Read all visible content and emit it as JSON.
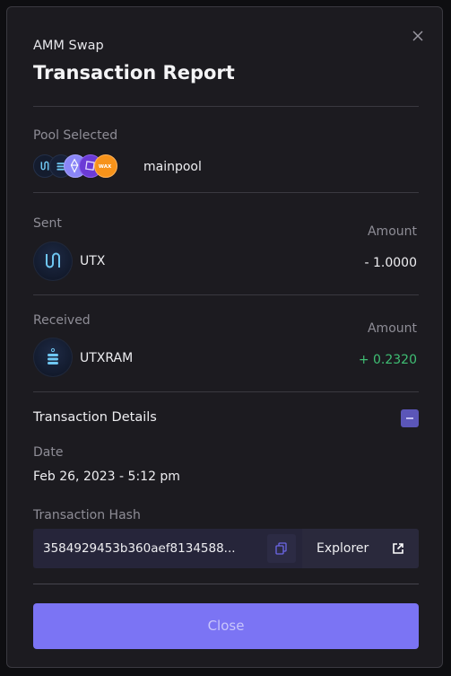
{
  "modal": {
    "subtitle": "AMM Swap",
    "title": "Transaction Report"
  },
  "pool": {
    "label": "Pool Selected",
    "name": "mainpool",
    "icons": [
      "utx-icon",
      "utxram-icon",
      "eos-icon",
      "purple-token-icon",
      "wax-icon"
    ],
    "wax_text": "WAX"
  },
  "sent": {
    "label": "Sent",
    "amount_label": "Amount",
    "token": "UTX",
    "amount": "- 1.0000"
  },
  "received": {
    "label": "Received",
    "amount_label": "Amount",
    "token": "UTXRAM",
    "amount": "+ 0.2320",
    "amount_color": "#3fbf74"
  },
  "details": {
    "title": "Transaction Details",
    "date_label": "Date",
    "date_value": "Feb 26, 2023 - 5:12 pm",
    "hash_label": "Transaction Hash",
    "hash_value": "3584929453b360aef8134588...",
    "explorer_label": "Explorer"
  },
  "footer": {
    "close_label": "Close"
  },
  "colors": {
    "accent": "#7b74f4",
    "positive": "#3fbf74"
  }
}
